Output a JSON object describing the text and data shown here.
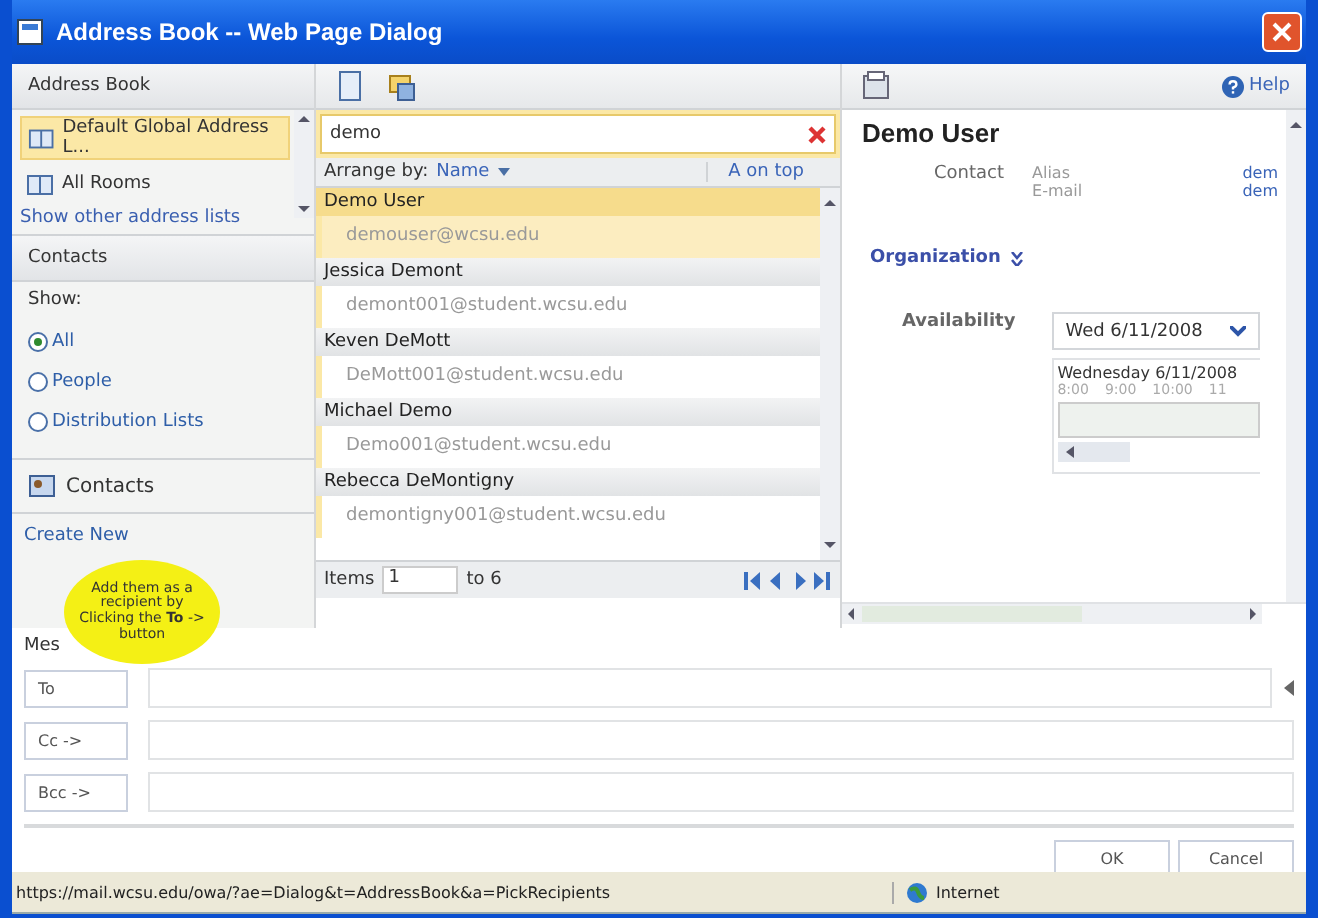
{
  "window": {
    "title": "Address Book -- Web Page Dialog"
  },
  "sidebar": {
    "header": "Address Book",
    "address_lists": [
      {
        "label": "Default Global Address L...",
        "selected": true
      },
      {
        "label": "All Rooms",
        "selected": false
      }
    ],
    "more_link": "Show other address lists",
    "contacts_header": "Contacts",
    "show_label": "Show:",
    "filters": [
      {
        "label": "All",
        "selected": true
      },
      {
        "label": "People",
        "selected": false
      },
      {
        "label": "Distribution Lists",
        "selected": false
      }
    ],
    "nav_item": "Contacts",
    "create_link": "Create New"
  },
  "results": {
    "search": {
      "value": "demo"
    },
    "arrange_label": "Arrange by:",
    "arrange_value": "Name",
    "sort_order": "A on top",
    "rows": [
      {
        "name": "Demo User",
        "email": "demouser@wcsu.edu",
        "selected": true
      },
      {
        "name": "Jessica Demont",
        "email": "demont001@student.wcsu.edu",
        "selected": false
      },
      {
        "name": "Keven DeMott",
        "email": "DeMott001@student.wcsu.edu",
        "selected": false
      },
      {
        "name": "Michael Demo",
        "email": "Demo001@student.wcsu.edu",
        "selected": false
      },
      {
        "name": "Rebecca DeMontigny",
        "email": "demontigny001@student.wcsu.edu",
        "selected": false
      }
    ],
    "items_label": "Items",
    "items_from": "1",
    "items_to": "to 6"
  },
  "details": {
    "help": "Help",
    "name": "Demo User",
    "contact_label": "Contact",
    "fields": [
      {
        "label": "Alias",
        "value": "dem"
      },
      {
        "label": "E-mail",
        "value": "dem"
      }
    ],
    "organization": "Organization",
    "availability_label": "Availability",
    "date": "Wed 6/11/2008",
    "day_title": "Wednesday 6/11/2008",
    "hours": [
      "8:00",
      "9:00",
      "10:00",
      "11"
    ]
  },
  "recipients": {
    "label": "Mes",
    "buttons": [
      "To",
      "Cc ->",
      "Bcc ->"
    ]
  },
  "callout": "Add them as a recipient by Clicking the **To** -> button",
  "buttons": [
    "OK",
    "Cancel"
  ],
  "status_bar": {
    "url": "https://mail.wcsu.edu/owa/?ae=Dialog&t=AddressBook&a=PickRecipients",
    "zone": "Internet"
  }
}
